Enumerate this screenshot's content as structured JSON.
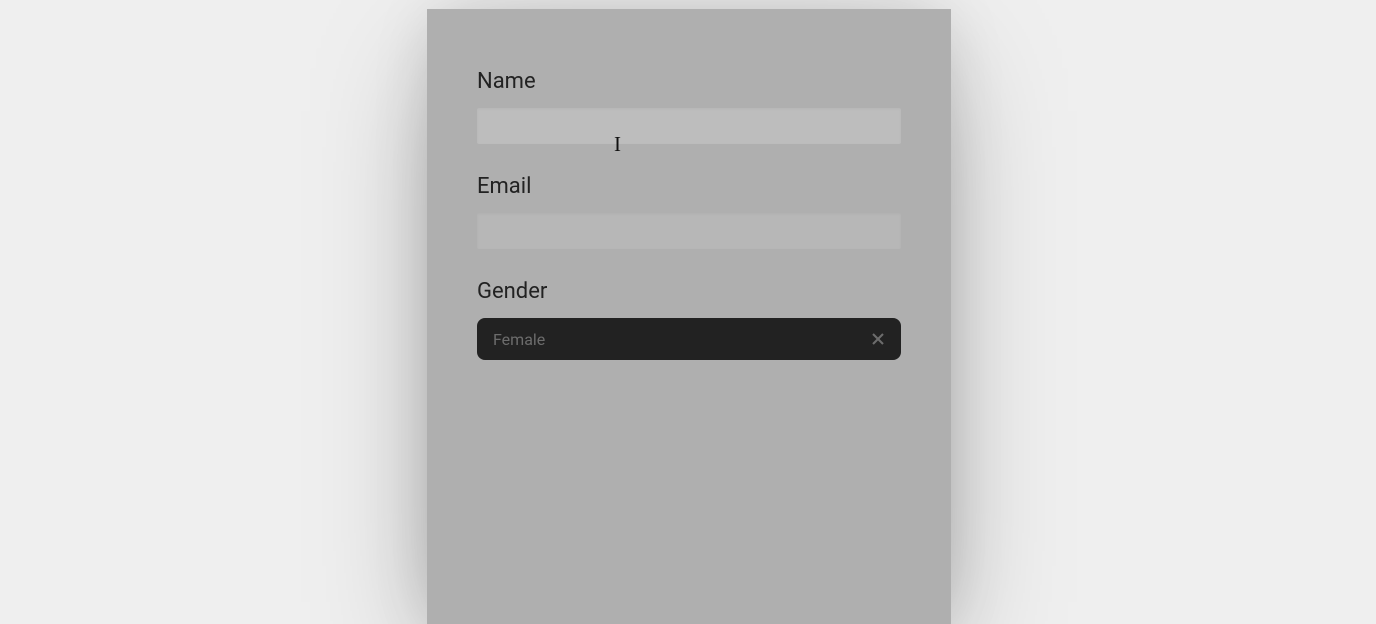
{
  "form": {
    "name": {
      "label": "Name",
      "value": ""
    },
    "email": {
      "label": "Email",
      "value": ""
    },
    "gender": {
      "label": "Gender",
      "selected": "Female"
    }
  },
  "cursor": {
    "glyph": "I"
  }
}
